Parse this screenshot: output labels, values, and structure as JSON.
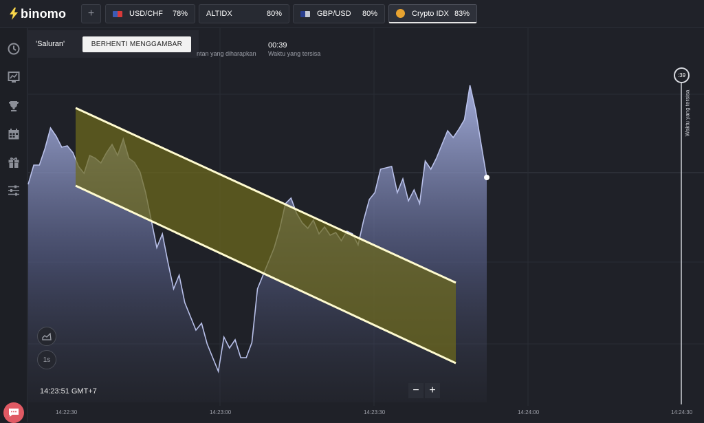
{
  "brand": {
    "name": "binomo"
  },
  "toolbar": {
    "add_label": "+"
  },
  "assets": [
    {
      "name": "USD/CHF",
      "pct": "78%",
      "flag": "us-ch"
    },
    {
      "name": "ALTIDX",
      "pct": "80%",
      "flag": "none"
    },
    {
      "name": "GBP/USD",
      "pct": "80%",
      "flag": "gb-us"
    },
    {
      "name": "Crypto IDX",
      "pct": "83%",
      "flag": "crypto",
      "active": true
    }
  ],
  "sidebar": {
    "items": [
      {
        "icon": "clock-icon"
      },
      {
        "icon": "chart-icon"
      },
      {
        "icon": "trophy-icon"
      },
      {
        "icon": "calendar-icon"
      },
      {
        "icon": "gift-icon"
      },
      {
        "icon": "sliders-icon"
      }
    ]
  },
  "drawing": {
    "tool_name": "'Saluran'",
    "stop_label": "BERHENTI MENGGAMBAR"
  },
  "trade_info": {
    "expected_label_partial": "ntan yang diharapkan",
    "timer_value": "00:39",
    "timer_label": "Waktu yang tersisa"
  },
  "chart_controls": {
    "timeframe": "1s",
    "zoom_out": "−",
    "zoom_in": "+"
  },
  "time_display": "14:23:51 GMT+7",
  "x_ticks": [
    "14:22:30",
    "14:23:00",
    "14:23:30",
    "14:24:00",
    "14:24:30"
  ],
  "timer_bubble": ":39",
  "vertical_label": "Waktu yang tersisa",
  "colors": {
    "accent_yellow": "#f7d54a",
    "area_line": "#aab3e0",
    "channel_fill": "#6e6a1c",
    "chat_red": "#e05a64"
  },
  "chart_data": {
    "type": "area",
    "series": [
      {
        "values": [
          268,
          240,
          240,
          216,
          186,
          198,
          214,
          212,
          222,
          242,
          252,
          226,
          230,
          237,
          222,
          210,
          226,
          202,
          230,
          236,
          250,
          280,
          320,
          360,
          340,
          382,
          420,
          400,
          440,
          460,
          480,
          470,
          500,
          520,
          540,
          490,
          506,
          494,
          520,
          520,
          498,
          420,
          400,
          380,
          360,
          332,
          296,
          288,
          310,
          324,
          332,
          320,
          340,
          330,
          342,
          338,
          350,
          336,
          340,
          356,
          320,
          290,
          280,
          246,
          244,
          242,
          280,
          260,
          292,
          276,
          296,
          234,
          246,
          230,
          210,
          190,
          200,
          188,
          174,
          124,
          160,
          210,
          258
        ]
      }
    ],
    "channel": {
      "upper": [
        [
          110,
          157
        ],
        [
          663,
          411
        ]
      ],
      "lower": [
        [
          110,
          270
        ],
        [
          663,
          528
        ]
      ]
    }
  }
}
